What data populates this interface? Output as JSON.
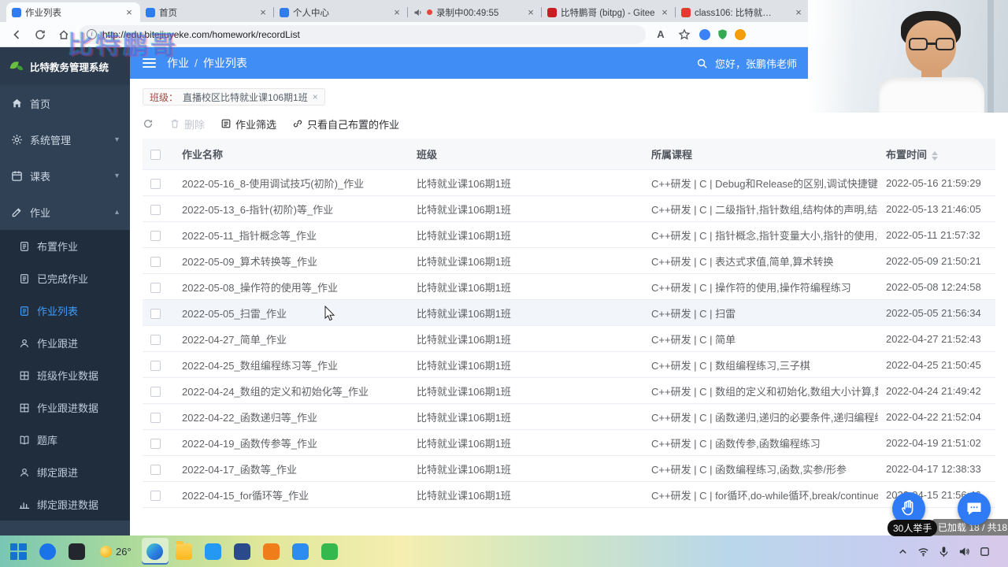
{
  "watermark_text": "比特鹏哥",
  "browser": {
    "url": "http://edu.bitejiuyeke.com/homework/recordList",
    "tabs": [
      {
        "label": "作业列表",
        "icon_color": "#2e7cf0",
        "active": true
      },
      {
        "label": "首页",
        "icon_color": "#2e7cf0",
        "active": false
      },
      {
        "label": "个人中心",
        "icon_color": "#2e7cf0",
        "active": false
      },
      {
        "label": "录制中00:49:55",
        "icon_color": "#f1f3f4",
        "active": false,
        "audio": true,
        "recording": true
      },
      {
        "label": "比特鹏哥 (bitpg) - Gitee.c…",
        "icon_color": "#c71d23",
        "active": false
      },
      {
        "label": "class106: 比特就…",
        "icon_color": "#e23c2f",
        "active": false
      }
    ]
  },
  "sidebar": {
    "logo_text": "比特教务管理系统",
    "items": [
      {
        "label": "首页",
        "icon": "home-icon",
        "arrow": false,
        "expanded": false
      },
      {
        "label": "系统管理",
        "icon": "gear-icon",
        "arrow": true,
        "expanded": false
      },
      {
        "label": "课表",
        "icon": "calendar-icon",
        "arrow": true,
        "expanded": false
      },
      {
        "label": "作业",
        "icon": "edit-icon",
        "arrow": true,
        "expanded": true
      }
    ],
    "sub_items": [
      {
        "label": "布置作业",
        "icon": "doc-icon",
        "active": false
      },
      {
        "label": "已完成作业",
        "icon": "doc-icon",
        "active": false
      },
      {
        "label": "作业列表",
        "icon": "doc-icon",
        "active": true
      },
      {
        "label": "作业跟进",
        "icon": "person-icon",
        "active": false
      },
      {
        "label": "班级作业数据",
        "icon": "grid-icon",
        "active": false
      },
      {
        "label": "作业跟进数据",
        "icon": "grid-icon",
        "active": false
      },
      {
        "label": "题库",
        "icon": "book-icon",
        "active": false
      },
      {
        "label": "绑定跟进",
        "icon": "person-icon",
        "active": false
      },
      {
        "label": "绑定跟进数据",
        "icon": "chart-icon",
        "active": false
      }
    ]
  },
  "header": {
    "breadcrumb": [
      "作业",
      "作业列表"
    ],
    "greeting": "您好，张鹏伟老师"
  },
  "filter_tag": {
    "label": "班级：",
    "value": "直播校区比特就业课106期1班"
  },
  "toolbar": {
    "delete": "删除",
    "filter": "作业筛选",
    "only_mine": "只看自己布置的作业"
  },
  "table": {
    "columns": [
      "作业名称",
      "班级",
      "所属课程",
      "布置时间"
    ],
    "hovered_row_index": 5,
    "rows": [
      {
        "name": "2022-05-16_8-使用调试技巧(初阶)_作业",
        "class": "比特就业课106期1班",
        "course": "C++研发 | C | Debug和Release的区别,调试快捷键,程序常",
        "time": "2022-05-16 21:59:29"
      },
      {
        "name": "2022-05-13_6-指针(初阶)等_作业",
        "class": "比特就业课106期1班",
        "course": "C++研发 | C | 二级指针,指针数组,结构体的声明,结构体成",
        "time": "2022-05-13 21:46:05"
      },
      {
        "name": "2022-05-11_指针概念等_作业",
        "class": "比特就业课106期1班",
        "course": "C++研发 | C | 指针概念,指针变量大小,指针的使用,指针类",
        "time": "2022-05-11 21:57:32"
      },
      {
        "name": "2022-05-09_算术转换等_作业",
        "class": "比特就业课106期1班",
        "course": "C++研发 | C | 表达式求值,简单,算术转换",
        "time": "2022-05-09 21:50:21"
      },
      {
        "name": "2022-05-08_操作符的使用等_作业",
        "class": "比特就业课106期1班",
        "course": "C++研发 | C | 操作符的使用,操作符编程练习",
        "time": "2022-05-08 12:24:58"
      },
      {
        "name": "2022-05-05_扫雷_作业",
        "class": "比特就业课106期1班",
        "course": "C++研发 | C | 扫雷",
        "time": "2022-05-05 21:56:34"
      },
      {
        "name": "2022-04-27_简单_作业",
        "class": "比特就业课106期1班",
        "course": "C++研发 | C | 简单",
        "time": "2022-04-27 21:52:43"
      },
      {
        "name": "2022-04-25_数组编程练习等_作业",
        "class": "比特就业课106期1班",
        "course": "C++研发 | C | 数组编程练习,三子棋",
        "time": "2022-04-25 21:50:45"
      },
      {
        "name": "2022-04-24_数组的定义和初始化等_作业",
        "class": "比特就业课106期1班",
        "course": "C++研发 | C | 数组的定义和初始化,数组大小计算,数组的",
        "time": "2022-04-24 21:49:42"
      },
      {
        "name": "2022-04-22_函数递归等_作业",
        "class": "比特就业课106期1班",
        "course": "C++研发 | C | 函数递归,递归的必要条件,递归编程练习",
        "time": "2022-04-22 21:52:04"
      },
      {
        "name": "2022-04-19_函数传参等_作业",
        "class": "比特就业课106期1班",
        "course": "C++研发 | C | 函数传参,函数编程练习",
        "time": "2022-04-19 21:51:02"
      },
      {
        "name": "2022-04-17_函数等_作业",
        "class": "比特就业课106期1班",
        "course": "C++研发 | C | 函数编程练习,函数,实参/形参",
        "time": "2022-04-17 12:38:33"
      },
      {
        "name": "2022-04-15_for循环等_作业",
        "class": "比特就业课106期1班",
        "course": "C++研发 | C | for循环,do-while循环,break/continue,二分",
        "time": "2022-04-15 21:56:46"
      }
    ]
  },
  "floating": {
    "raise_hand_label": "30人举手",
    "load_status": "已加载 18 / 共18"
  },
  "taskbar": {
    "weather_temp": "26°",
    "apps_left": [
      {
        "name": "start-button",
        "shape": "win",
        "color": "#1572d3",
        "active": false
      },
      {
        "name": "search-app",
        "shape": "circle",
        "color": "#1a73e8",
        "active": false
      },
      {
        "name": "dark-app",
        "shape": "square",
        "color": "#23262e",
        "active": false
      }
    ],
    "apps": [
      {
        "name": "edge-browser",
        "shape": "circle",
        "color": "linear-gradient(135deg,#49d2c5 0%,#2b7fe3 55%,#1b5fb8 100%)",
        "active": true
      },
      {
        "name": "file-explorer",
        "shape": "folder",
        "color": "#fcb81f",
        "active": false
      },
      {
        "name": "vscode",
        "shape": "square",
        "color": "#2499f3",
        "active": false
      },
      {
        "name": "navy-app",
        "shape": "square",
        "color": "#2b4a8b",
        "active": false
      },
      {
        "name": "orange-app",
        "shape": "square",
        "color": "#ef7e1a",
        "active": false
      },
      {
        "name": "blue-app",
        "shape": "square",
        "color": "#2d8cf0",
        "active": false
      },
      {
        "name": "wechat",
        "shape": "square",
        "color": "#35b94e",
        "active": false
      }
    ],
    "tray": [
      "chevron-up-icon",
      "wifi-icon",
      "mic-icon",
      "volume-icon",
      "notification-icon"
    ]
  }
}
